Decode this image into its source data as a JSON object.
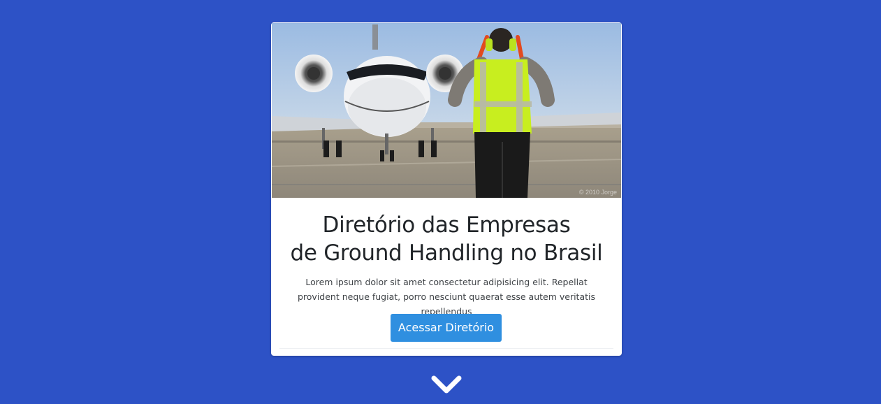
{
  "card": {
    "image": {
      "alt": "airplane-marshaller-photo",
      "watermark": "© 2010 Jorge"
    },
    "title_line1": "Diretório das Empresas",
    "title_line2": "de Ground Handling no Brasil",
    "description": "Lorem ipsum dolor sit amet consectetur adipisicing elit. Repellat provident neque fugiat, porro nesciunt quaerat esse autem veritatis repellendus",
    "cta_label": "Acessar Diretório"
  },
  "scroll_indicator": {
    "icon": "chevron-down-icon"
  },
  "colors": {
    "background": "#2d52c6",
    "card": "#ffffff",
    "button": "#2f8fe0",
    "text": "#212529"
  }
}
